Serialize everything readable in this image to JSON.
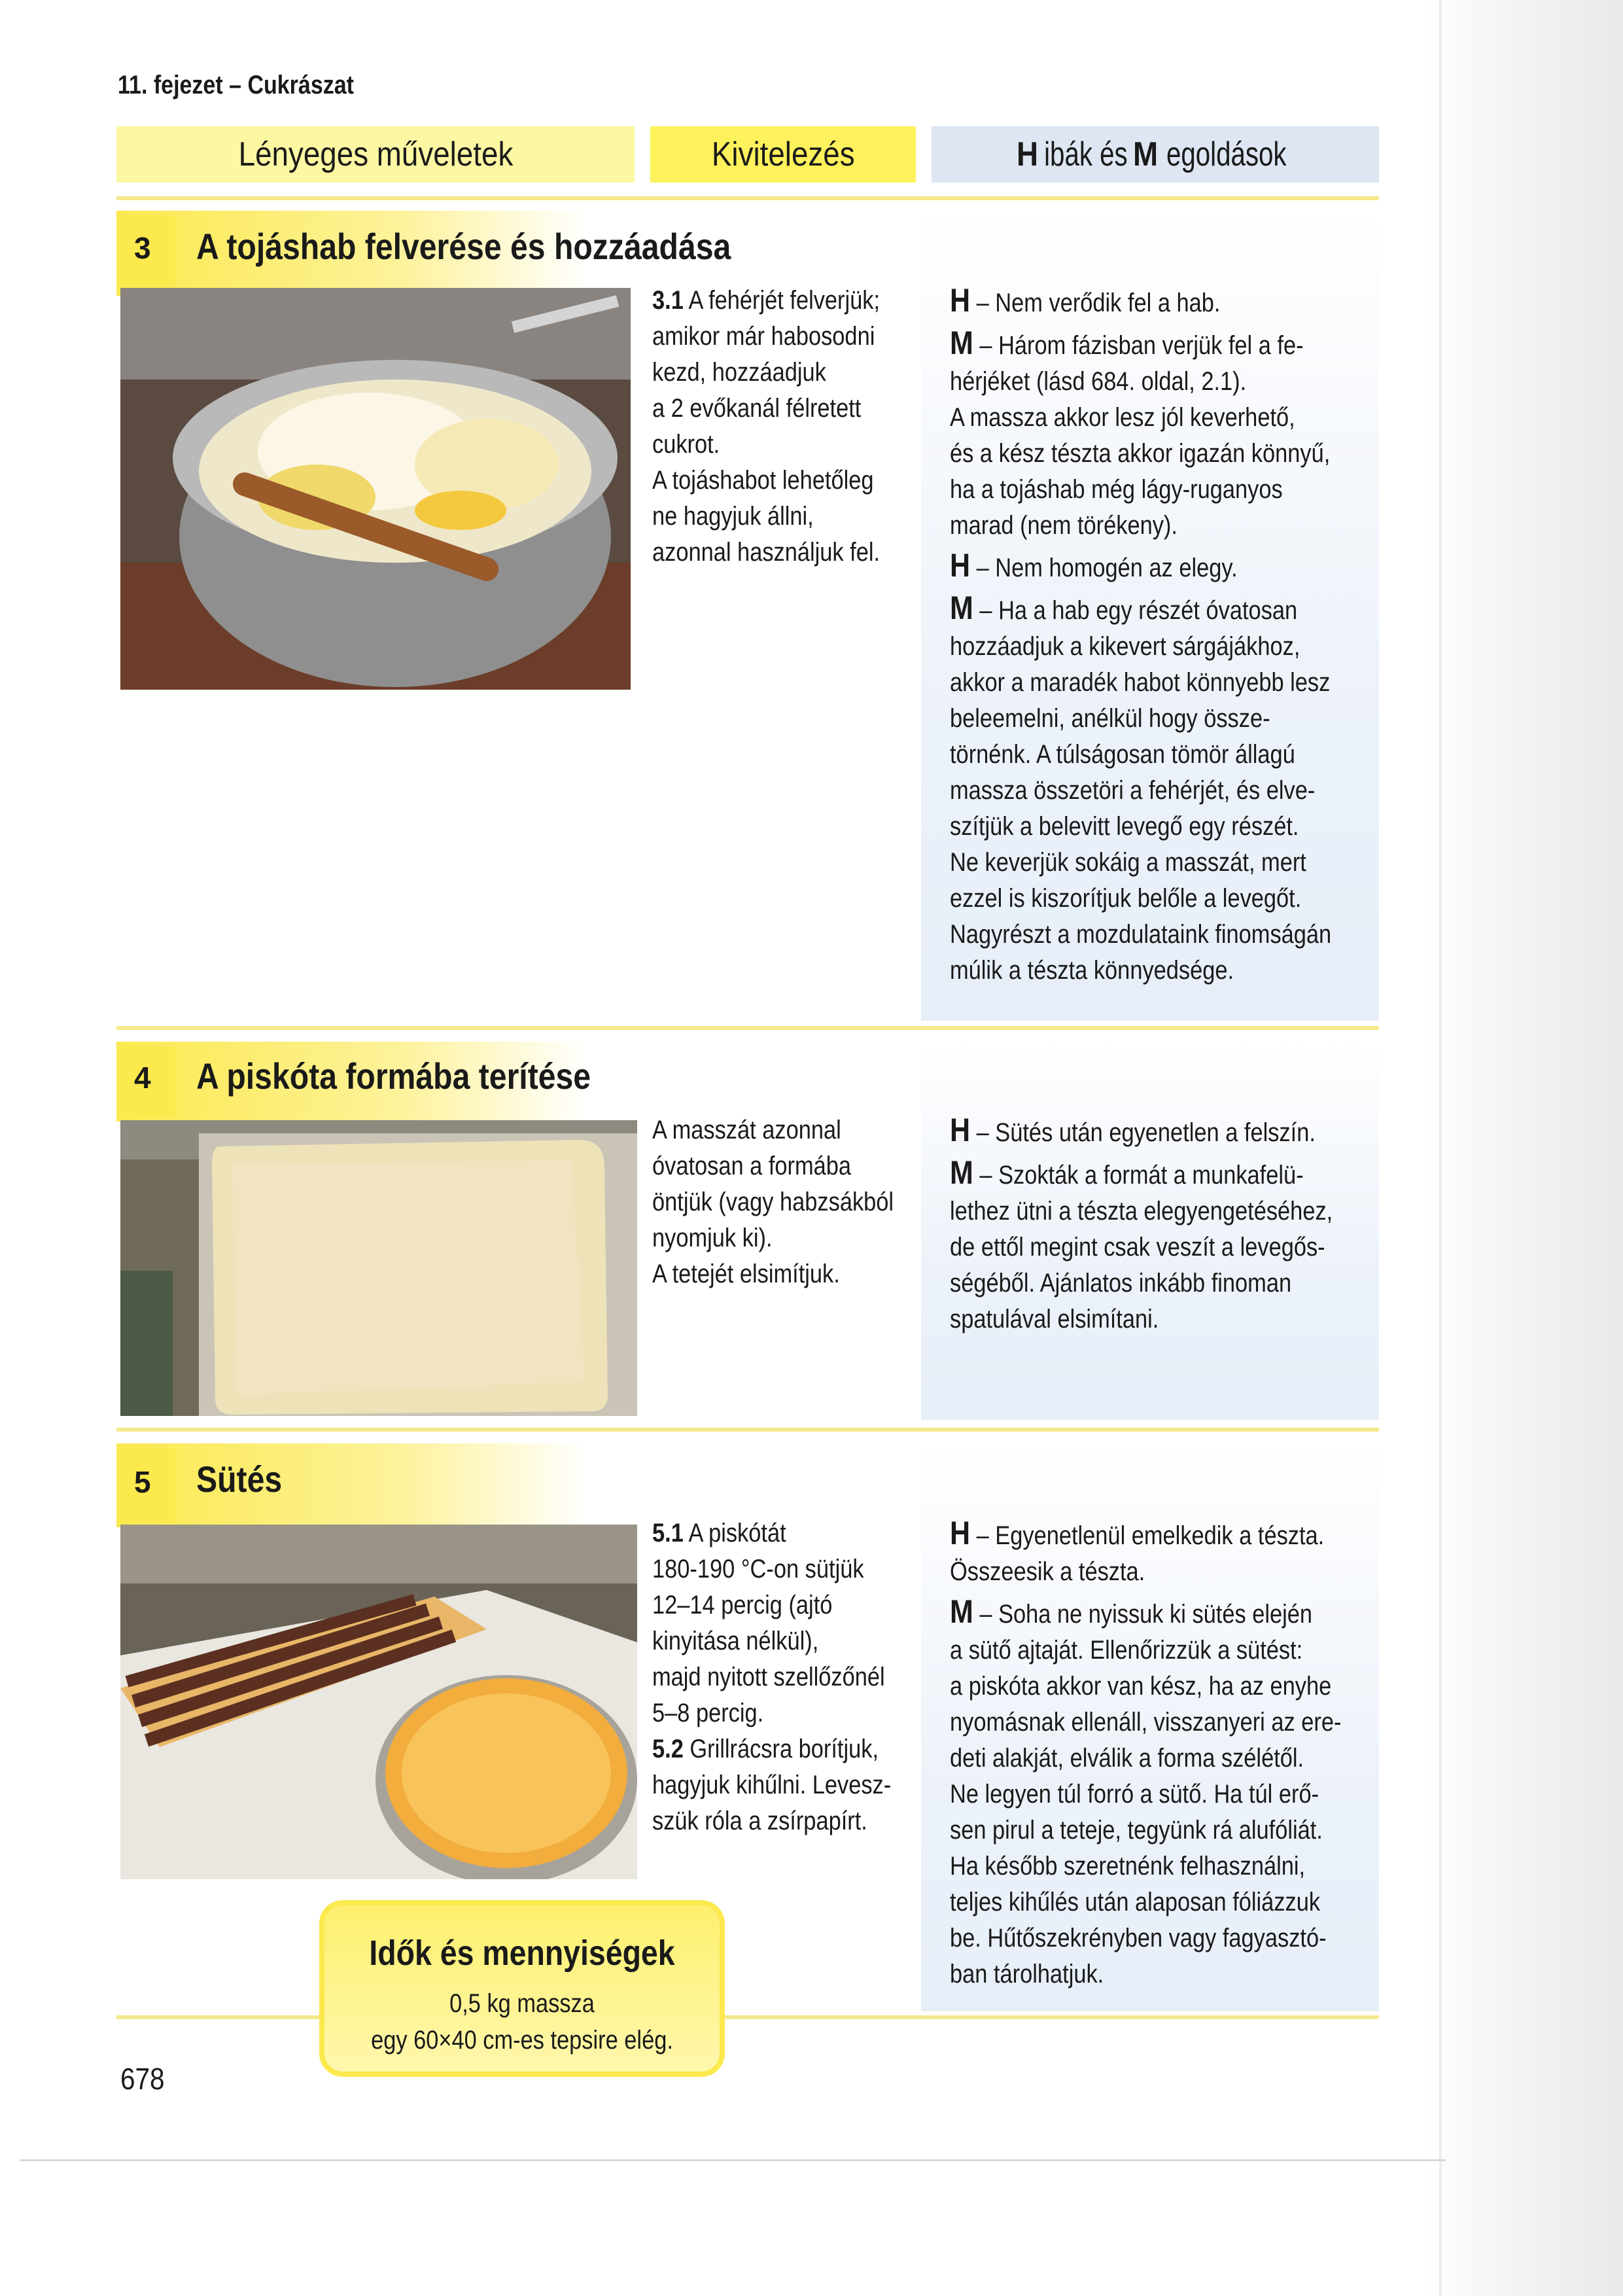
{
  "chapter_header": "11. fejezet – Cukrászat",
  "columns": {
    "essential_ops": "Lényeges műveletek",
    "execution": "Kivitelezés",
    "problems_solutions_h": "H",
    "problems_solutions_h_rest": "ibák és ",
    "problems_solutions_m": "M",
    "problems_solutions_m_rest": "egoldások"
  },
  "steps": [
    {
      "number": "3",
      "title": "A tojáshab felverése és hozzáadása",
      "photo_icon": "egg-white-foam-bowl-photo",
      "instruction_bold": "3.1",
      "instruction_lines": [
        " A fehérjét felverjük;",
        "amikor már habosodni",
        "kezd, hozzáadjuk",
        "a 2 evőkanál félretett",
        "cukrot.",
        "A tojáshabot lehetőleg",
        "ne hagyjuk állni,",
        "azonnal használjuk fel."
      ],
      "problems": [
        {
          "letter": "H",
          "lines": [
            " – Nem verődik fel a hab."
          ]
        },
        {
          "letter": "M",
          "lines": [
            " – Három fázisban verjük fel a fe-",
            "hérjéket (lásd 684. oldal, 2.1).",
            "A massza akkor lesz jól keverhető,",
            "és a kész tészta akkor igazán könnyű,",
            "ha a tojáshab még lágy-ruganyos",
            "marad (nem törékeny)."
          ]
        },
        {
          "letter": "H",
          "lines": [
            " – Nem homogén az elegy."
          ]
        },
        {
          "letter": "M",
          "lines": [
            " – Ha a hab egy részét óvatosan",
            "hozzáadjuk a kikevert sárgájákhoz,",
            "akkor a maradék habot könnyebb lesz",
            "beleemelni, anélkül hogy össze-",
            "törnénk. A túlságosan tömör állagú",
            "massza összetöri a fehérjét, és elve-",
            "szítjük a belevitt levegő egy részét.",
            "Ne keverjük sokáig a masszát, mert",
            "ezzel is kiszorítjuk belőle a levegőt.",
            "Nagyrészt a mozdulataink finomságán",
            "múlik a tészta könnyedsége."
          ]
        }
      ]
    },
    {
      "number": "4",
      "title": "A piskóta formába terítése",
      "photo_icon": "sponge-batter-in-tray-photo",
      "instruction_lines": [
        "A masszát azonnal",
        "óvatosan a formába",
        "öntjük (vagy habzsákból",
        "nyomjuk ki).",
        "A tetejét elsimítjuk."
      ],
      "problems": [
        {
          "letter": "H",
          "lines": [
            " – Sütés után egyenetlen a felszín."
          ]
        },
        {
          "letter": "M",
          "lines": [
            " – Szokták a formát a munkafelü-",
            "lethez ütni a tészta elegyengetéséhez,",
            "de ettől megint csak veszít a levegős-",
            "ségéből. Ajánlatos inkább finoman",
            "spatulával elsimítani."
          ]
        }
      ]
    },
    {
      "number": "5",
      "title": "Sütés",
      "photo_icon": "baked-sponge-cake-photo",
      "instruction_blocks": [
        {
          "bold": "5.1",
          "lines": [
            " A piskótát",
            "180-190 °C-on sütjük",
            "12–14 percig (ajtó",
            "kinyitása nélkül),",
            "majd nyitott szellőzőnél",
            "5–8 percig."
          ]
        },
        {
          "bold": "5.2",
          "lines": [
            " Grillrácsra borítjuk,",
            "hagyjuk kihűlni. Levesz-",
            "szük róla a zsírpapírt."
          ]
        }
      ],
      "problems": [
        {
          "letter": "H",
          "lines": [
            " – Egyenetlenül emelkedik a tészta.",
            "Összeesik a tészta."
          ]
        },
        {
          "letter": "M",
          "lines": [
            " – Soha ne nyissuk ki sütés elején",
            "a sütő ajtaját. Ellenőrizzük a sütést:",
            "a piskóta akkor van kész, ha az enyhe",
            "nyomásnak ellenáll, visszanyeri az ere-",
            "deti alakját, elválik a forma szélétől.",
            "Ne legyen túl forró a sütő. Ha túl erő-",
            "sen pirul a teteje, tegyünk rá alufóliát.",
            "Ha később szeretnénk felhasználni,",
            "teljes kihűlés után alaposan fóliázzuk",
            "be. Hűtőszekrényben vagy fagyasztó-",
            "ban tárolhatjuk."
          ]
        }
      ]
    }
  ],
  "info_box": {
    "title": "Idők és mennyiségek",
    "lines": [
      "0,5 kg massza",
      "egy 60×40 cm-es tepsire elég."
    ]
  },
  "page_number": "678",
  "colors": {
    "yellow_accent": "#fbe94e",
    "header_yellow": "#fdf25c",
    "header_pale": "#fcf7a2",
    "blue_panel": "#e6eef8"
  }
}
